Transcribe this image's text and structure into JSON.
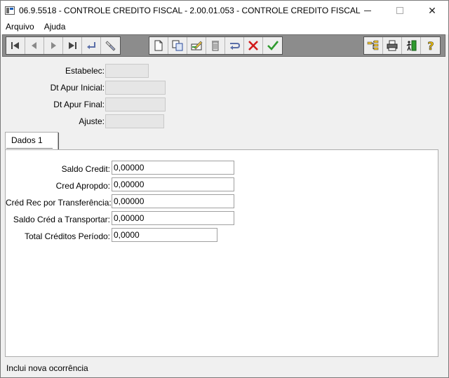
{
  "window": {
    "title": "06.9.5518 - CONTROLE CREDITO FISCAL - 2.00.01.053 - CONTROLE CREDITO FISCAL",
    "minimize": "",
    "maximize": "",
    "close": "✕"
  },
  "menu": {
    "items": [
      "Arquivo",
      "Ajuda"
    ]
  },
  "toolbar": {
    "nav_icons": [
      "first-record-icon",
      "previous-record-icon",
      "next-record-icon",
      "last-record-icon",
      "go-to-icon",
      "search-icon"
    ],
    "action_icons": [
      "new-record-icon",
      "copy-record-icon",
      "edit-record-icon",
      "delete-record-icon",
      "undo-icon",
      "cancel-icon",
      "confirm-icon"
    ],
    "tool_icons": [
      "tree-icon",
      "print-icon",
      "exit-icon",
      "help-icon"
    ]
  },
  "header": {
    "fields": [
      {
        "label": "Estabelec:",
        "value": ""
      },
      {
        "label": "Dt Apur Inicial:",
        "value": ""
      },
      {
        "label": "Dt Apur Final:",
        "value": ""
      },
      {
        "label": "Ajuste:",
        "value": ""
      }
    ]
  },
  "tabs": [
    {
      "label": "Dados 1"
    }
  ],
  "form": {
    "fields": [
      {
        "label": "Saldo Credit:",
        "value": "0,00000"
      },
      {
        "label": "Cred Apropdo:",
        "value": "0,00000"
      },
      {
        "label": "Créd Rec por Transferência:",
        "value": "0,00000"
      },
      {
        "label": "Saldo Créd a Transportar:",
        "value": "0,00000"
      },
      {
        "label": "Total Créditos Período:",
        "value": "0,0000"
      }
    ]
  },
  "status": {
    "text": "Inclui nova ocorrência"
  },
  "colors": {
    "toolbar_bg": "#8c8c8c",
    "readonly_field": "#e6e6e6",
    "cancel_red": "#d11a1a",
    "confirm_green": "#2e9a2e"
  }
}
